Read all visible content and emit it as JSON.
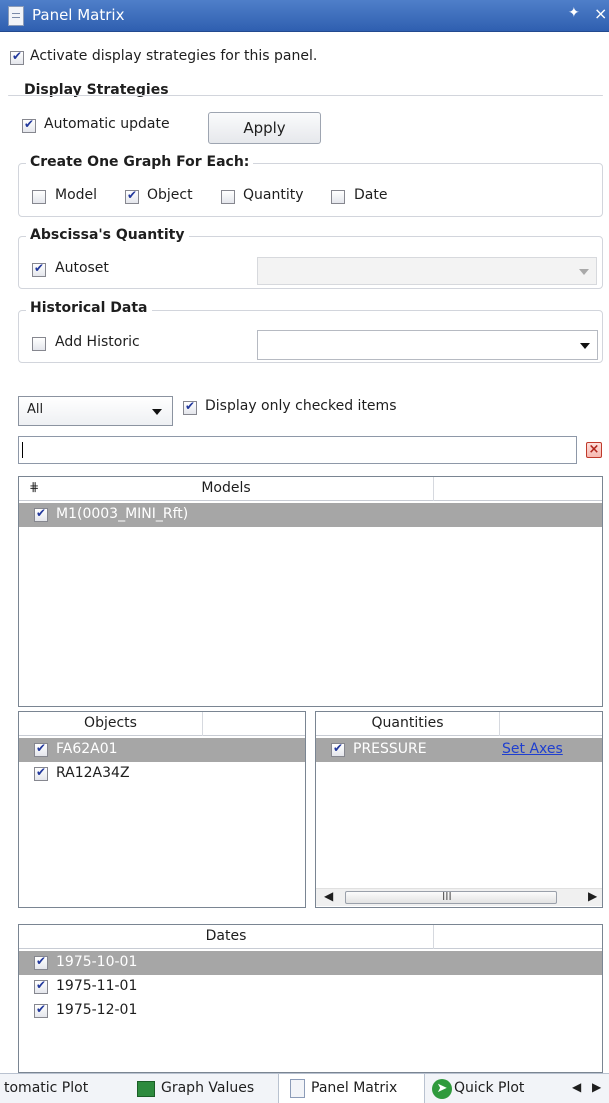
{
  "window": {
    "title": "Panel Matrix"
  },
  "activate": {
    "label": "Activate display strategies for this panel.",
    "checked": true
  },
  "display_strategies": {
    "heading": "Display Strategies",
    "auto_update": {
      "label": "Automatic update",
      "checked": true
    },
    "apply_label": "Apply",
    "one_graph": {
      "heading": "Create One Graph For Each:",
      "options": [
        {
          "label": "Model",
          "checked": false
        },
        {
          "label": "Object",
          "checked": true
        },
        {
          "label": "Quantity",
          "checked": false
        },
        {
          "label": "Date",
          "checked": false
        }
      ]
    },
    "abscissa": {
      "heading": "Abscissa's Quantity",
      "autoset": {
        "label": "Autoset",
        "checked": true
      },
      "value": ""
    },
    "historical": {
      "heading": "Historical Data",
      "add_historic": {
        "label": "Add Historic",
        "checked": false
      },
      "value": ""
    }
  },
  "filter": {
    "selected": "All",
    "only_checked": {
      "label": "Display only checked items",
      "checked": true
    },
    "search_value": ""
  },
  "models": {
    "header": "Models",
    "rows": [
      {
        "label": "M1(0003_MINI_Rft)",
        "checked": true,
        "selected": true
      }
    ]
  },
  "objects": {
    "header": "Objects",
    "rows": [
      {
        "label": "FA62A01",
        "checked": true,
        "selected": true
      },
      {
        "label": "RA12A34Z",
        "checked": true,
        "selected": false
      }
    ]
  },
  "quantities": {
    "header": "Quantities",
    "rows": [
      {
        "label": "PRESSURE",
        "checked": true,
        "selected": true,
        "link": "Set Axes"
      }
    ],
    "scroll_thumb": "III"
  },
  "dates": {
    "header": "Dates",
    "rows": [
      {
        "label": "1975-10-01",
        "checked": true,
        "selected": true
      },
      {
        "label": "1975-11-01",
        "checked": true,
        "selected": false
      },
      {
        "label": "1975-12-01",
        "checked": true,
        "selected": false
      }
    ]
  },
  "tabs": [
    {
      "label": "tomatic Plot",
      "icon": "none",
      "active": false
    },
    {
      "label": "Graph Values",
      "icon": "spreadsheet-icon",
      "active": false
    },
    {
      "label": "Panel Matrix",
      "icon": "document-icon",
      "active": true
    },
    {
      "label": "Quick Plot",
      "icon": "runner-icon",
      "active": false
    }
  ],
  "colors": {
    "title_bar": "#3d6dbd",
    "selection": "#a6a6a6",
    "link": "#1f3fcf"
  }
}
